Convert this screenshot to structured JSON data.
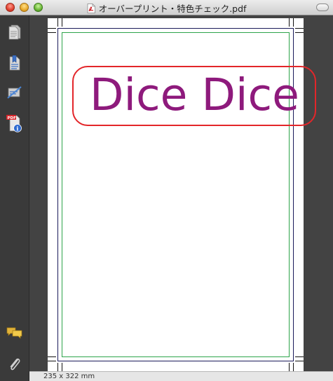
{
  "window": {
    "title": "オーバープリント・特色チェック.pdf"
  },
  "sidebar": {
    "items": [
      {
        "icon": "document-pages-icon"
      },
      {
        "icon": "bookmark-document-icon"
      },
      {
        "icon": "annotation-tool-icon"
      },
      {
        "icon": "pdf-info-icon"
      },
      {
        "icon": "comments-icon"
      },
      {
        "icon": "attachments-paperclip-icon"
      }
    ]
  },
  "document": {
    "text": "Dice Dice",
    "text_color": "#8e1a7c",
    "highlight_color": "#e3262a",
    "trim_color": "#2da44a"
  },
  "status": {
    "page_size": "235 x 322 mm"
  }
}
